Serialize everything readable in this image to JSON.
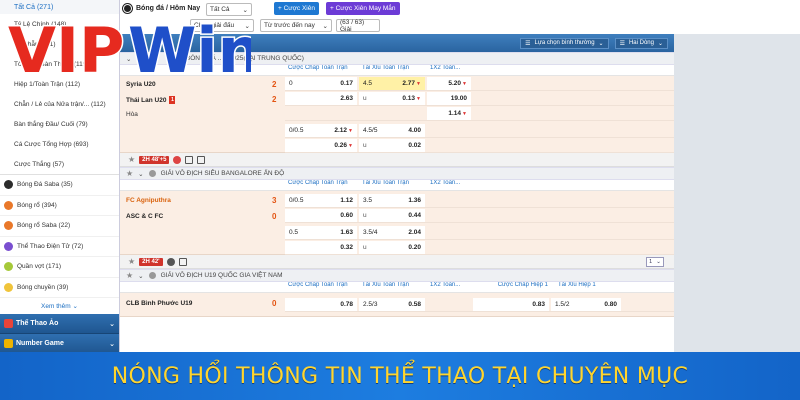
{
  "sidebar": {
    "all_label": "Tất Cả (271)",
    "categories": [
      "Tỷ Lệ Chính (148)",
      "Lẻ/Chẵn (151)",
      "Tổng Số Bàn Thắng (119)",
      "Hiệp 1/Toàn Trận (112)",
      "Chẵn / Lẻ của Nửa trận/... (112)",
      "Bàn thắng Đầu/ Cuối (79)",
      "Cá Cược Tổng Hợp (693)",
      "Cược Thắng (57)"
    ],
    "sports": [
      {
        "label": "Bóng Đá Saba (35)",
        "color": "#2c2c2c"
      },
      {
        "label": "Bóng rổ (394)",
        "color": "#e9782a"
      },
      {
        "label": "Bóng rổ Saba (22)",
        "color": "#e9782a"
      },
      {
        "label": "Thể Thao Điện Tử (72)",
        "color": "#7a4fd0"
      },
      {
        "label": "Quần vợt (171)",
        "color": "#a6c93a"
      },
      {
        "label": "Bóng chuyền (39)",
        "color": "#f0c43a"
      }
    ],
    "see_more": "Xem thêm",
    "groups": [
      {
        "label": "Thể Thao Ảo"
      },
      {
        "label": "Number Game"
      }
    ]
  },
  "topbar": {
    "breadcrumb": "Bóng đá / Hôm Nay",
    "sport_filter": "Tất Cả",
    "league_filter": "Chọn giải đấu",
    "time_filter": "Từ trước đến nay",
    "league_count": "(63 / 63) Giải",
    "btn_bet": "Cược Xiên",
    "btn_lucky": "Cược Xiên May Mắn"
  },
  "board": {
    "sort_label": "Lựa chọn bình thường",
    "odds_type": "Hai Dòng",
    "columns": [
      "Cược Chấp Toàn Trận",
      "Tài Xỉu Toàn Trận",
      "1X2 Toàn..."
    ],
    "columns_ext": [
      "Cược Chấp Toàn Trận",
      "Tài Xỉu Toàn Trận",
      "1X2 Toàn...",
      "Cược Chấp Hiệp 1",
      "Tài Xỉu Hiệp 1"
    ],
    "leagues": [
      {
        "name": "...P BÓNG ĐÁ ...A 2025(TẠI TRUNG QUỐC)",
        "match": {
          "home": "Syria U20",
          "away": "Thái Lan U20",
          "away_cards": "1",
          "home_score": "2",
          "away_score": "2",
          "draw": "Hòa",
          "rows": [
            {
              "hdp": "0",
              "hdp_odds": "0.17",
              "ou": "4.5",
              "ou_odds": "2.77",
              "x12": "5.20"
            },
            {
              "hdp": "",
              "hdp_odds": "2.63",
              "ou": "u",
              "ou_odds": "0.13",
              "x12": "19.00"
            },
            {
              "hdp": "",
              "hdp_odds": "",
              "ou": "",
              "ou_odds": "",
              "x12": "1.14"
            },
            {
              "hdp": "0/0.5",
              "hdp_odds": "2.12",
              "ou": "4.5/5",
              "ou_odds": "4.00",
              "x12": ""
            },
            {
              "hdp": "",
              "hdp_odds": "0.26",
              "ou": "u",
              "ou_odds": "0.02",
              "x12": ""
            }
          ],
          "live": "2H 48'+5"
        }
      },
      {
        "name": "GIẢI VÔ ĐỊCH SIÊU BANGALORE ẤN ĐỘ",
        "match": {
          "home": "FC Agniputhra",
          "away": "ASC & C FC",
          "home_score": "3",
          "away_score": "0",
          "rows": [
            {
              "hdp": "0/0.5",
              "hdp_odds": "1.12",
              "ou": "3.5",
              "ou_odds": "1.36"
            },
            {
              "hdp": "",
              "hdp_odds": "0.60",
              "ou": "u",
              "ou_odds": "0.44"
            },
            {
              "hdp": "0.5",
              "hdp_odds": "1.63",
              "ou": "3.5/4",
              "ou_odds": "2.04"
            },
            {
              "hdp": "",
              "hdp_odds": "0.32",
              "ou": "u",
              "ou_odds": "0.20"
            }
          ],
          "live": "2H 42'",
          "page": "1"
        }
      },
      {
        "name": "GIẢI VÔ ĐỊCH U19 QUỐC GIA VIỆT NAM",
        "match": {
          "home": "CLB Bình Phước U19",
          "home_score": "0",
          "row": {
            "hdp_odds": "0.78",
            "ou": "2.5/3",
            "ou_odds": "0.58",
            "h1_odds": "0.83",
            "h1_ou": "1.5/2",
            "h1_ou_odds": "0.80"
          }
        }
      }
    ]
  },
  "logo_text": "VIPWin",
  "banner": {
    "text": "NÓNG HỔI THÔNG TIN THỂ THAO TẠI CHUYÊN MỤC"
  },
  "colors": {
    "brand_blue": "#1e78d2",
    "banner_text": "#ffd52e",
    "logo_red": "#e62a1f",
    "logo_blue": "#1f4fc9",
    "match_bg": "#fbeee4",
    "score_orange": "#e35412"
  }
}
